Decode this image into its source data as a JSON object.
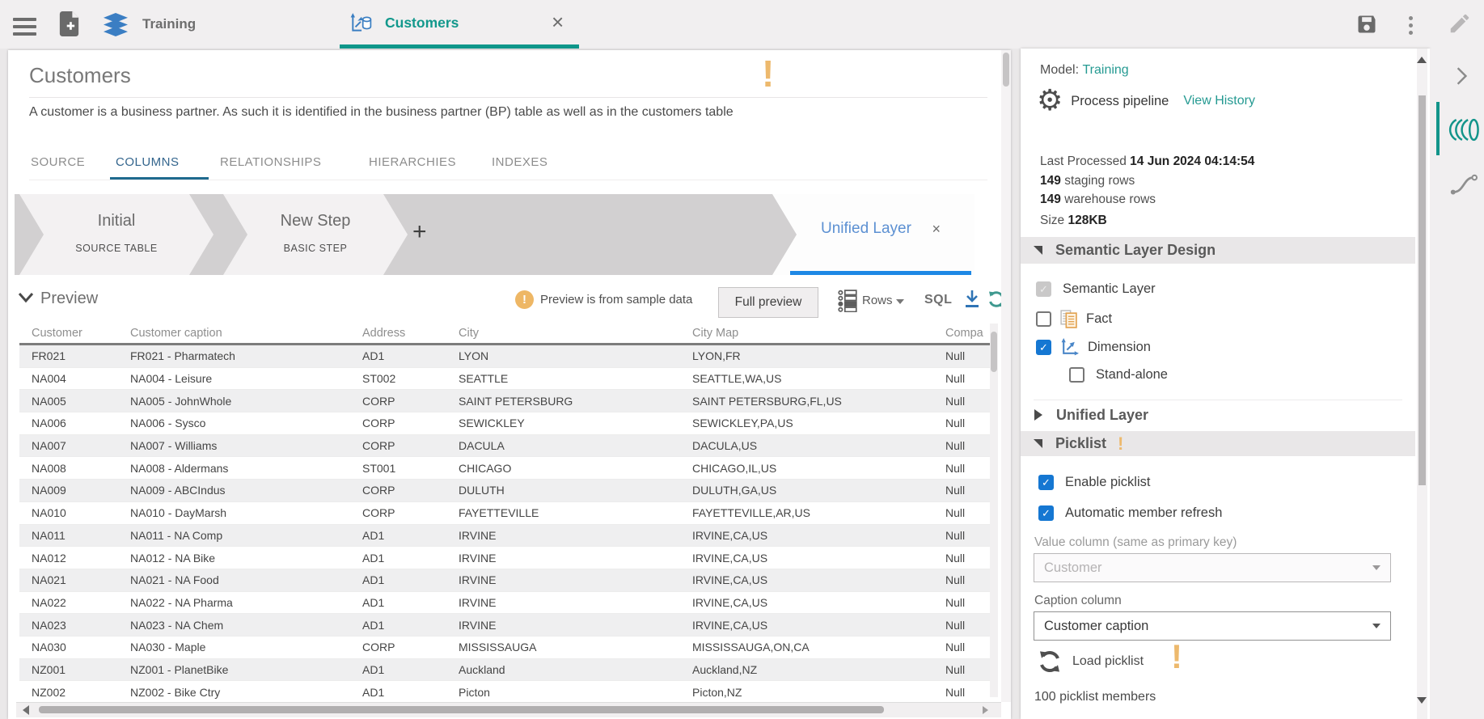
{
  "topbar": {
    "workspace_label": "Training",
    "tab": {
      "label": "Customers",
      "close": "×"
    }
  },
  "content": {
    "title": "Customers",
    "warning_mark": "!",
    "description": "A customer is a business partner. As such it is identified in the business partner (BP) table as well as in the customers table",
    "tabs": [
      {
        "label": "SOURCE"
      },
      {
        "label": "COLUMNS"
      },
      {
        "label": "RELATIONSHIPS"
      },
      {
        "label": "HIERARCHIES"
      },
      {
        "label": "INDEXES"
      }
    ],
    "pipeline": {
      "steps": [
        {
          "title": "Initial",
          "subtitle": "SOURCE TABLE"
        },
        {
          "title": "New Step",
          "subtitle": "BASIC STEP"
        }
      ],
      "add_button": "+",
      "unified_step": {
        "title": "Unified Layer",
        "close": "×"
      }
    },
    "preview": {
      "title": "Preview",
      "warning_mark": "!",
      "sample_warning": "Preview is from sample data",
      "full_preview_button": "Full preview",
      "rows_button": "Rows",
      "sql_button": "SQL"
    },
    "table": {
      "columns": [
        "Customer",
        "Customer caption",
        "Address",
        "City",
        "City Map",
        "Compa"
      ],
      "rows": [
        [
          "FR021",
          "FR021 - Pharmatech",
          "AD1",
          "LYON",
          "LYON,FR",
          "Null"
        ],
        [
          "NA004",
          "NA004 - Leisure",
          "ST002",
          "SEATTLE",
          "SEATTLE,WA,US",
          "Null"
        ],
        [
          "NA005",
          "NA005 - JohnWhole",
          "CORP",
          "SAINT PETERSBURG",
          "SAINT PETERSBURG,FL,US",
          "Null"
        ],
        [
          "NA006",
          "NA006 - Sysco",
          "CORP",
          "SEWICKLEY",
          "SEWICKLEY,PA,US",
          "Null"
        ],
        [
          "NA007",
          "NA007 - Williams",
          "CORP",
          "DACULA",
          "DACULA,US",
          "Null"
        ],
        [
          "NA008",
          "NA008 - Aldermans",
          "ST001",
          "CHICAGO",
          "CHICAGO,IL,US",
          "Null"
        ],
        [
          "NA009",
          "NA009 - ABCIndus",
          "CORP",
          "DULUTH",
          "DULUTH,GA,US",
          "Null"
        ],
        [
          "NA010",
          "NA010 - DayMarsh",
          "CORP",
          "FAYETTEVILLE",
          "FAYETTEVILLE,AR,US",
          "Null"
        ],
        [
          "NA011",
          "NA011 - NA Comp",
          "AD1",
          "IRVINE",
          "IRVINE,CA,US",
          "Null"
        ],
        [
          "NA012",
          "NA012 - NA Bike",
          "AD1",
          "IRVINE",
          "IRVINE,CA,US",
          "Null"
        ],
        [
          "NA021",
          "NA021 - NA Food",
          "AD1",
          "IRVINE",
          "IRVINE,CA,US",
          "Null"
        ],
        [
          "NA022",
          "NA022 - NA Pharma",
          "AD1",
          "IRVINE",
          "IRVINE,CA,US",
          "Null"
        ],
        [
          "NA023",
          "NA023 - NA Chem",
          "AD1",
          "IRVINE",
          "IRVINE,CA,US",
          "Null"
        ],
        [
          "NA030",
          "NA030 - Maple",
          "CORP",
          "MISSISSAUGA",
          "MISSISSAUGA,ON,CA",
          "Null"
        ],
        [
          "NZ001",
          "NZ001 - PlanetBike",
          "AD1",
          "Auckland",
          "Auckland,NZ",
          "Null"
        ],
        [
          "NZ002",
          "NZ002 - Bike Ctry",
          "AD1",
          "Picton",
          "Picton,NZ",
          "Null"
        ],
        [
          "",
          "",
          "",
          "...",
          "...",
          "..."
        ]
      ]
    }
  },
  "sidebar": {
    "model_label": "Model:",
    "model_name": "Training",
    "process_pipeline": "Process pipeline",
    "view_history": "View History",
    "last_processed_label": "Last Processed",
    "last_processed_value": "14 Jun 2024 04:14:54",
    "staging_rows_value": "149",
    "staging_rows_label": "staging rows",
    "warehouse_rows_value": "149",
    "warehouse_rows_label": "warehouse rows",
    "size_label": "Size",
    "size_value": "128KB",
    "semantic_section": {
      "title": "Semantic Layer Design",
      "items": [
        {
          "label": "Semantic Layer",
          "checked": true,
          "disabled": true
        },
        {
          "label": "Fact",
          "checked": false,
          "disabled": false
        },
        {
          "label": "Dimension",
          "checked": true,
          "disabled": false
        },
        {
          "label": "Stand-alone",
          "checked": false,
          "disabled": false
        }
      ]
    },
    "unified_section": {
      "title": "Unified Layer"
    },
    "picklist_section": {
      "title": "Picklist",
      "warning_mark": "!",
      "checkboxes": [
        {
          "label": "Enable picklist",
          "checked": true
        },
        {
          "label": "Automatic member refresh",
          "checked": true
        }
      ],
      "value_column_label": "Value column (same as primary key)",
      "value_column_value": "Customer",
      "caption_column_label": "Caption column",
      "caption_column_value": "Customer caption",
      "load_button": "Load picklist",
      "load_warning_mark": "!",
      "members_text": "100 picklist members"
    }
  },
  "colors": {
    "accent_teal": "#0f968a",
    "link_teal": "#259a92",
    "checkbox_blue": "#1577d2",
    "active_tab_blue": "#33658d",
    "unified_blue": "#5c90d2",
    "warning_orange": "#edb96d"
  }
}
